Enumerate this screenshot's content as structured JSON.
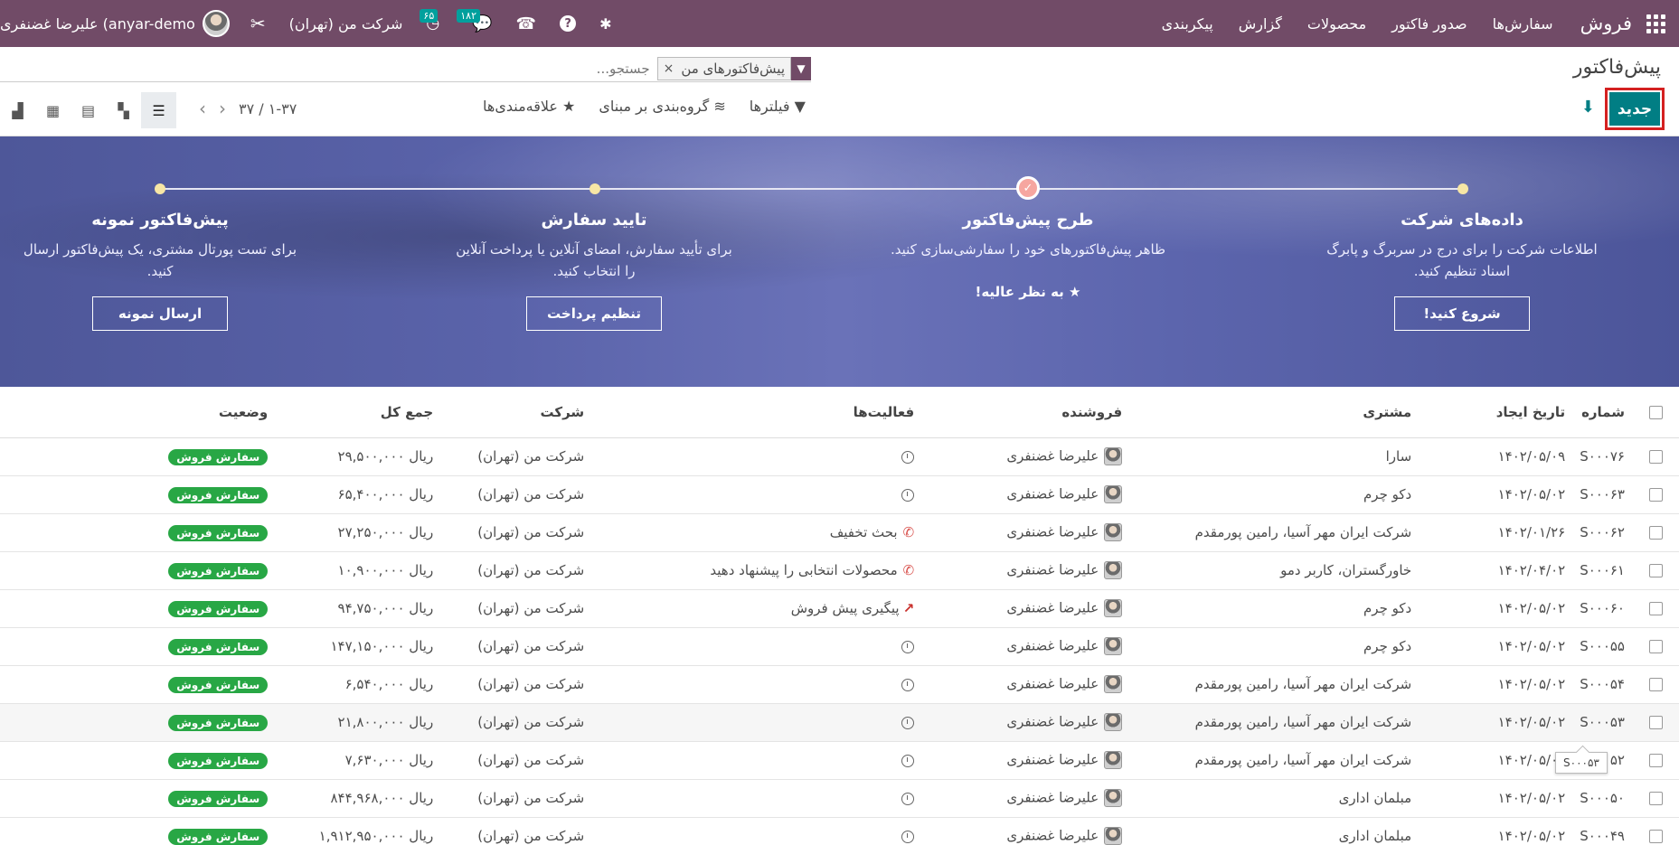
{
  "navbar": {
    "brand": "فروش",
    "menu": [
      "سفارش‌ها",
      "صدور فاکتور",
      "محصولات",
      "گزارش",
      "پیکربندی"
    ],
    "user_name": "علیرضا غضنفری (anyar-demo",
    "company": "شرکت من (تهران)",
    "activity_count": "۶۵",
    "messages_count": "۱۸۲"
  },
  "control_panel": {
    "title": "پیش‌فاکتور",
    "new_label": "جدید",
    "facet_label": "پیش‌فاکتورهای من",
    "facet_remove": "×",
    "search_placeholder": "جستجو...",
    "filters_label": "فیلترها",
    "groupby_label": "گروه‌بندی بر مبنای",
    "favorites_label": "علاقه‌مندی‌ها",
    "pager": "۱-۳۷ / ۳۷"
  },
  "banner": {
    "steps": [
      {
        "title": "داده‌های شرکت",
        "text": "اطلاعات شرکت را برای درج در سربرگ و پابرگ اسناد تنظیم کنید.",
        "button": "شروع کنید!"
      },
      {
        "title": "طرح پیش‌فاکتور",
        "text": "ظاهر پیش‌فاکتورهای خود را سفارشی‌سازی کنید.",
        "done_label": "به نظر عالیه!"
      },
      {
        "title": "تایید سفارش",
        "text": "برای تأیید سفارش، امضای آنلاین یا پرداخت آنلاین را انتخاب کنید.",
        "button": "تنظیم پرداخت"
      },
      {
        "title": "پیش‌فاکتور نمونه",
        "text": "برای تست پورتال مشتری، یک پیش‌فاکتور ارسال کنید.",
        "button": "ارسال نمونه"
      }
    ]
  },
  "table": {
    "headers": {
      "number": "شماره",
      "date": "تاریخ ایجاد",
      "customer": "مشتری",
      "salesperson": "فروشنده",
      "activities": "فعالیت‌ها",
      "company": "شرکت",
      "total": "جمع کل",
      "status": "وضعیت"
    },
    "rows": [
      {
        "number": "S۰۰۰۷۶",
        "date": "۱۴۰۲/۰۵/۰۹",
        "customer": "سارا",
        "salesperson": "علیرضا غضنفری",
        "activity": "",
        "activity_type": "clock",
        "company": "شرکت من (تهران)",
        "total": "ریال ۲۹,۵۰۰,۰۰۰",
        "status": "سفارش فروش"
      },
      {
        "number": "S۰۰۰۶۳",
        "date": "۱۴۰۲/۰۵/۰۲",
        "customer": "دکو چرم",
        "salesperson": "علیرضا غضنفری",
        "activity": "",
        "activity_type": "clock",
        "company": "شرکت من (تهران)",
        "total": "ریال ۶۵,۴۰۰,۰۰۰",
        "status": "سفارش فروش"
      },
      {
        "number": "S۰۰۰۶۲",
        "date": "۱۴۰۲/۰۱/۲۶",
        "customer": "شرکت ایران مهر آسیا، رامین پورمقدم",
        "salesperson": "علیرضا غضنفری",
        "activity": "بحث تخفیف",
        "activity_type": "phone",
        "company": "شرکت من (تهران)",
        "total": "ریال ۲۷,۲۵۰,۰۰۰",
        "status": "سفارش فروش"
      },
      {
        "number": "S۰۰۰۶۱",
        "date": "۱۴۰۲/۰۴/۰۲",
        "customer": "خاورگستران، کاربر دمو",
        "salesperson": "علیرضا غضنفری",
        "activity": "محصولات انتخابی را پیشنهاد دهید",
        "activity_type": "phone",
        "company": "شرکت من (تهران)",
        "total": "ریال ۱۰,۹۰۰,۰۰۰",
        "status": "سفارش فروش"
      },
      {
        "number": "S۰۰۰۶۰",
        "date": "۱۴۰۲/۰۵/۰۲",
        "customer": "دکو چرم",
        "salesperson": "علیرضا غضنفری",
        "activity": "پیگیری پیش فروش",
        "activity_type": "trend",
        "company": "شرکت من (تهران)",
        "total": "ریال ۹۴,۷۵۰,۰۰۰",
        "status": "سفارش فروش"
      },
      {
        "number": "S۰۰۰۵۵",
        "date": "۱۴۰۲/۰۵/۰۲",
        "customer": "دکو چرم",
        "salesperson": "علیرضا غضنفری",
        "activity": "",
        "activity_type": "clock",
        "company": "شرکت من (تهران)",
        "total": "ریال ۱۴۷,۱۵۰,۰۰۰",
        "status": "سفارش فروش"
      },
      {
        "number": "S۰۰۰۵۴",
        "date": "۱۴۰۲/۰۵/۰۲",
        "customer": "شرکت ایران مهر آسیا، رامین پورمقدم",
        "salesperson": "علیرضا غضنفری",
        "activity": "",
        "activity_type": "clock",
        "company": "شرکت من (تهران)",
        "total": "ریال ۶,۵۴۰,۰۰۰",
        "status": "سفارش فروش"
      },
      {
        "number": "S۰۰۰۵۳",
        "date": "۱۴۰۲/۰۵/۰۲",
        "customer": "شرکت ایران مهر آسیا، رامین پورمقدم",
        "salesperson": "علیرضا غضنفری",
        "activity": "",
        "activity_type": "clock",
        "company": "شرکت من (تهران)",
        "total": "ریال ۲۱,۸۰۰,۰۰۰",
        "status": "سفارش فروش"
      },
      {
        "number": "S۰۰۰۵۲",
        "date": "۱۴۰۲/۰۵/۰۲",
        "customer": "شرکت ایران مهر آسیا، رامین پورمقدم",
        "salesperson": "علیرضا غضنفری",
        "activity": "",
        "activity_type": "clock",
        "company": "شرکت من (تهران)",
        "total": "ریال ۷,۶۳۰,۰۰۰",
        "status": "سفارش فروش"
      },
      {
        "number": "S۰۰۰۵۰",
        "date": "۱۴۰۲/۰۵/۰۲",
        "customer": "مبلمان اداری",
        "salesperson": "علیرضا غضنفری",
        "activity": "",
        "activity_type": "clock",
        "company": "شرکت من (تهران)",
        "total": "ریال ۸۴۴,۹۶۸,۰۰۰",
        "status": "سفارش فروش"
      },
      {
        "number": "S۰۰۰۴۹",
        "date": "۱۴۰۲/۰۵/۰۲",
        "customer": "مبلمان اداری",
        "salesperson": "علیرضا غضنفری",
        "activity": "",
        "activity_type": "clock",
        "company": "شرکت من (تهران)",
        "total": "ریال ۱,۹۱۲,۹۵۰,۰۰۰",
        "status": "سفارش فروش"
      }
    ],
    "tooltip": "S۰۰۰۵۳"
  }
}
